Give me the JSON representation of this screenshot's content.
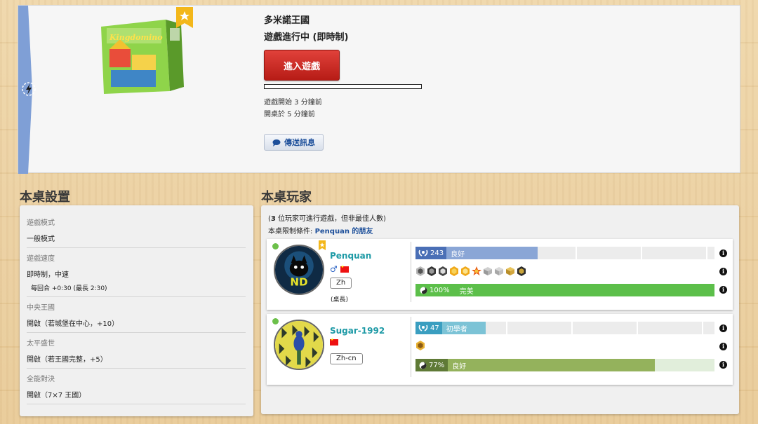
{
  "game": {
    "title": "多米諾王國",
    "status": "遊戲進行中 (即時制)",
    "enter_button": "進入遊戲",
    "started_ago": "遊戲開始 3 分鐘前",
    "opened_ago": "開桌於 5 分鐘前",
    "message_button": "傳送訊息",
    "box_art_text": "Kingdomino"
  },
  "headings": {
    "settings": "本桌設置",
    "players": "本桌玩家"
  },
  "settings": [
    {
      "name": "遊戲模式",
      "value": "一般模式",
      "sub": ""
    },
    {
      "name": "遊戲速度",
      "value": "即時制，中速",
      "sub": "每回合 +0:30 (最長 2:30)"
    },
    {
      "name": "中央王國",
      "value": "開啟（若城堡在中心，+10）",
      "sub": ""
    },
    {
      "name": "太平盛世",
      "value": "開啟（若王國完整，+5）",
      "sub": ""
    },
    {
      "name": "全能對決",
      "value": "開啟（7×7 王國）",
      "sub": ""
    }
  ],
  "players_panel": {
    "note_count": "3",
    "note_text": " 位玩家可進行遊戲，但非最佳人數)",
    "note_open": "(",
    "restriction_label": "本桌限制條件: ",
    "restriction_value": "Penquan 的朋友"
  },
  "players": [
    {
      "name": "Penquan",
      "gender": "♂",
      "language": "Zh",
      "role": "(桌長)",
      "elo": "243",
      "elo_label": "良好",
      "elo_fraction": 0.34,
      "reliability": "100%",
      "reliability_label": "完美",
      "reliability_fraction": 1.0,
      "achievement_count": 10
    },
    {
      "name": "Sugar-1992",
      "gender": "",
      "language": "Zh-cn",
      "role": "",
      "elo": "47",
      "elo_label": "初學者",
      "elo_fraction": 0.16,
      "reliability": "77%",
      "reliability_label": "良好",
      "reliability_fraction": 0.8,
      "achievement_count": 1
    }
  ],
  "colors": {
    "elo_bar_good": "#8aa6d6",
    "elo_icon_good": "#4a6fb6",
    "elo_bar_beginner": "#7cc3d6",
    "elo_icon_beginner": "#3a9ec0",
    "reliability_perfect": "#5cbf4a",
    "reliability_good": "#94b25c",
    "reliability_good_icon": "#5f7a36",
    "enter_button": "#c62420",
    "player_name": "#1e9aa6"
  }
}
